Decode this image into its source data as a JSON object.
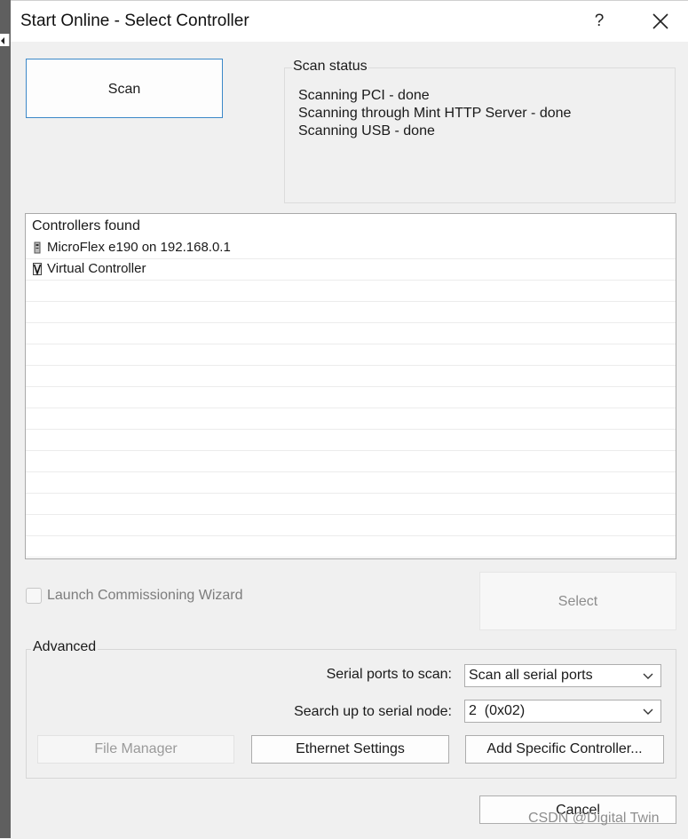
{
  "window": {
    "title": "Start Online - Select Controller",
    "help_label": "?"
  },
  "scan": {
    "button_label": "Scan"
  },
  "scan_status": {
    "legend": "Scan status",
    "lines": [
      "Scanning PCI - done",
      "Scanning through Mint HTTP Server - done",
      "Scanning USB - done"
    ]
  },
  "controllers": {
    "header": "Controllers found",
    "items": [
      {
        "label": "MicroFlex e190 on 192.168.0.1",
        "icon": "drive-icon"
      },
      {
        "label": "Virtual Controller",
        "icon": "virtual-controller-icon"
      }
    ]
  },
  "wizard": {
    "label": "Launch Commissioning Wizard",
    "checked": false
  },
  "select": {
    "label": "Select"
  },
  "advanced": {
    "legend": "Advanced",
    "serial_ports_label": "Serial ports to scan:",
    "serial_ports_value": "Scan all serial ports",
    "serial_node_label": "Search up to serial node:",
    "serial_node_value": "2  (0x02)",
    "file_manager_label": "File Manager",
    "ethernet_settings_label": "Ethernet Settings",
    "add_specific_label": "Add Specific Controller..."
  },
  "cancel": {
    "label": "Cancel"
  },
  "watermark": "CSDN @Digital Twin",
  "colors": {
    "focus_border": "#3c88c8",
    "dialog_bg": "#f0f0f0"
  }
}
